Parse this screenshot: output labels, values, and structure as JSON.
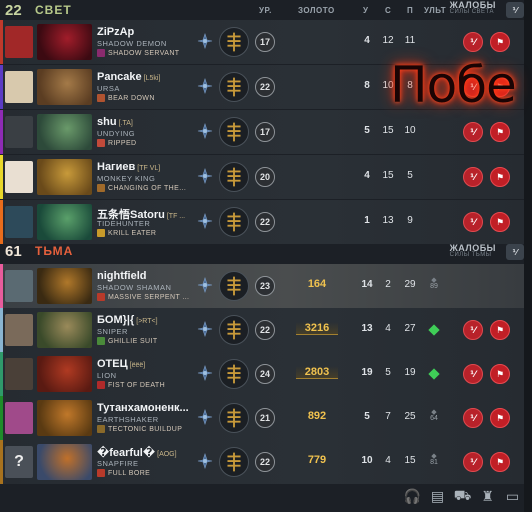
{
  "radiant": {
    "score": "22",
    "name": "СВЕТ",
    "columns": {
      "level": "УР.",
      "gold": "ЗОЛОТО",
      "kills": "У",
      "deaths": "С",
      "assists": "П",
      "ult": "УЛЬТ"
    },
    "complaints_title": "ЖАЛОБЫ",
    "complaints_sub": "СИЛЫ СВЕТА",
    "toggle_label": "⅟",
    "players": [
      {
        "name": "ZiPzAp",
        "tag": "",
        "hero": "SHADOW DEMON",
        "facet": "SHADOW SERVANT",
        "level": "17",
        "gold": "",
        "kills": "4",
        "deaths": "12",
        "assists": "11",
        "color": "#c0392b",
        "avatar_bg": "#a12828",
        "portrait": [
          "#3c0a12",
          "#a11d2a"
        ],
        "facet_color": "#8a2b6e"
      },
      {
        "name": "Pancake",
        "tag": "[L5ki]",
        "hero": "URSA",
        "facet": "BEAR DOWN",
        "level": "22",
        "gold": "",
        "kills": "8",
        "deaths": "10",
        "assists": "8",
        "color": "#5b3cc4",
        "avatar_bg": "#d8c9ad",
        "portrait": [
          "#5b3d22",
          "#a47a48"
        ],
        "facet_color": "#b05330"
      },
      {
        "name": "shu",
        "tag": "[.TA]",
        "hero": "UNDYING",
        "facet": "RIPPED",
        "level": "17",
        "gold": "",
        "kills": "5",
        "deaths": "15",
        "assists": "10",
        "color": "#8e2bb5",
        "avatar_bg": "#3a3f44",
        "portrait": [
          "#2d4a3a",
          "#6a9a6a"
        ],
        "facet_color": "#c24a3a"
      },
      {
        "name": "Нагиев",
        "tag": "[TF VL]",
        "hero": "MONKEY KING",
        "facet": "CHANGING OF THE...",
        "level": "20",
        "gold": "",
        "kills": "4",
        "deaths": "15",
        "assists": "5",
        "color": "#e8d72b",
        "avatar_bg": "#e9dfd2",
        "portrait": [
          "#6a4a1a",
          "#c89a3a"
        ],
        "facet_color": "#a06a2a"
      },
      {
        "name": "五条悟Satoru",
        "tag": "[TF ...",
        "hero": "TIDEHUNTER",
        "facet": "KRILL EATER",
        "level": "22",
        "gold": "",
        "kills": "1",
        "deaths": "13",
        "assists": "9",
        "color": "#e86c1c",
        "avatar_bg": "#2d4a5a",
        "portrait": [
          "#1a4a3a",
          "#5aa06a"
        ],
        "facet_color": "#c89a2a"
      }
    ]
  },
  "dire": {
    "score": "61",
    "name": "ТЬМА",
    "complaints_title": "ЖАЛОБЫ",
    "complaints_sub": "СИЛЫ ТЬМЫ",
    "toggle_label": "⅟",
    "players": [
      {
        "name": "nightfield",
        "tag": "",
        "hero": "SHADOW SHAMAN",
        "facet": "MASSIVE SERPENT ...",
        "level": "23",
        "gold": "164",
        "kills": "14",
        "deaths": "2",
        "assists": "29",
        "ult_cd": "89",
        "ult_ready": false,
        "color": "#e85c9c",
        "avatar_bg": "#5a6a72",
        "portrait": [
          "#3a2a12",
          "#b0782a"
        ],
        "facet_color": "#b83a2a"
      },
      {
        "name": "БОМ}|{",
        "tag": "[>RT<]",
        "hero": "SNIPER",
        "facet": "GHILLIE SUIT",
        "level": "22",
        "gold": "3216",
        "kills": "13",
        "deaths": "4",
        "assists": "27",
        "ult_cd": "",
        "ult_ready": true,
        "color": "#8ab5d1",
        "avatar_bg": "#7a6a5a",
        "portrait": [
          "#3a4a2a",
          "#9a8a5a"
        ],
        "facet_color": "#4a8a3a"
      },
      {
        "name": "ОТЕЦ",
        "tag": "[ëëë]",
        "hero": "LION",
        "facet": "FIST OF DEATH",
        "level": "24",
        "gold": "2803",
        "kills": "19",
        "deaths": "5",
        "assists": "19",
        "ult_cd": "",
        "ult_ready": true,
        "color": "#2f9a6a",
        "avatar_bg": "#4a4038",
        "portrait": [
          "#5a1a12",
          "#b03a22"
        ],
        "facet_color": "#b02a2a"
      },
      {
        "name": "Тутанхамоненк...",
        "tag": "",
        "hero": "EARTHSHAKER",
        "facet": "TECTONIC BUILDUP",
        "level": "21",
        "gold": "892",
        "kills": "5",
        "deaths": "7",
        "assists": "25",
        "ult_cd": "64",
        "ult_ready": false,
        "color": "#1e8c2a",
        "avatar_bg": "#a04a8a",
        "portrait": [
          "#5a3a12",
          "#c0782a"
        ],
        "facet_color": "#8a6a2a"
      },
      {
        "name": "�fearful�",
        "tag": "[AOG]",
        "hero": "SNAPFIRE",
        "facet": "FULL BORE",
        "level": "22",
        "gold": "779",
        "kills": "10",
        "deaths": "4",
        "assists": "15",
        "ult_cd": "81",
        "ult_ready": false,
        "color": "#a8721e",
        "avatar_bg": "#4a5058",
        "avatar_text": "?",
        "portrait": [
          "#3a4a6a",
          "#c0702a"
        ],
        "facet_color": "#b83a2a"
      }
    ]
  },
  "overlay_text": "Побе",
  "buttons": {
    "mute": "⅟",
    "report": "⚑"
  },
  "footer_icons": [
    "headset-icon",
    "scoreboard-icon",
    "cosmetics-icon",
    "tree-icon",
    "chat-icon"
  ]
}
